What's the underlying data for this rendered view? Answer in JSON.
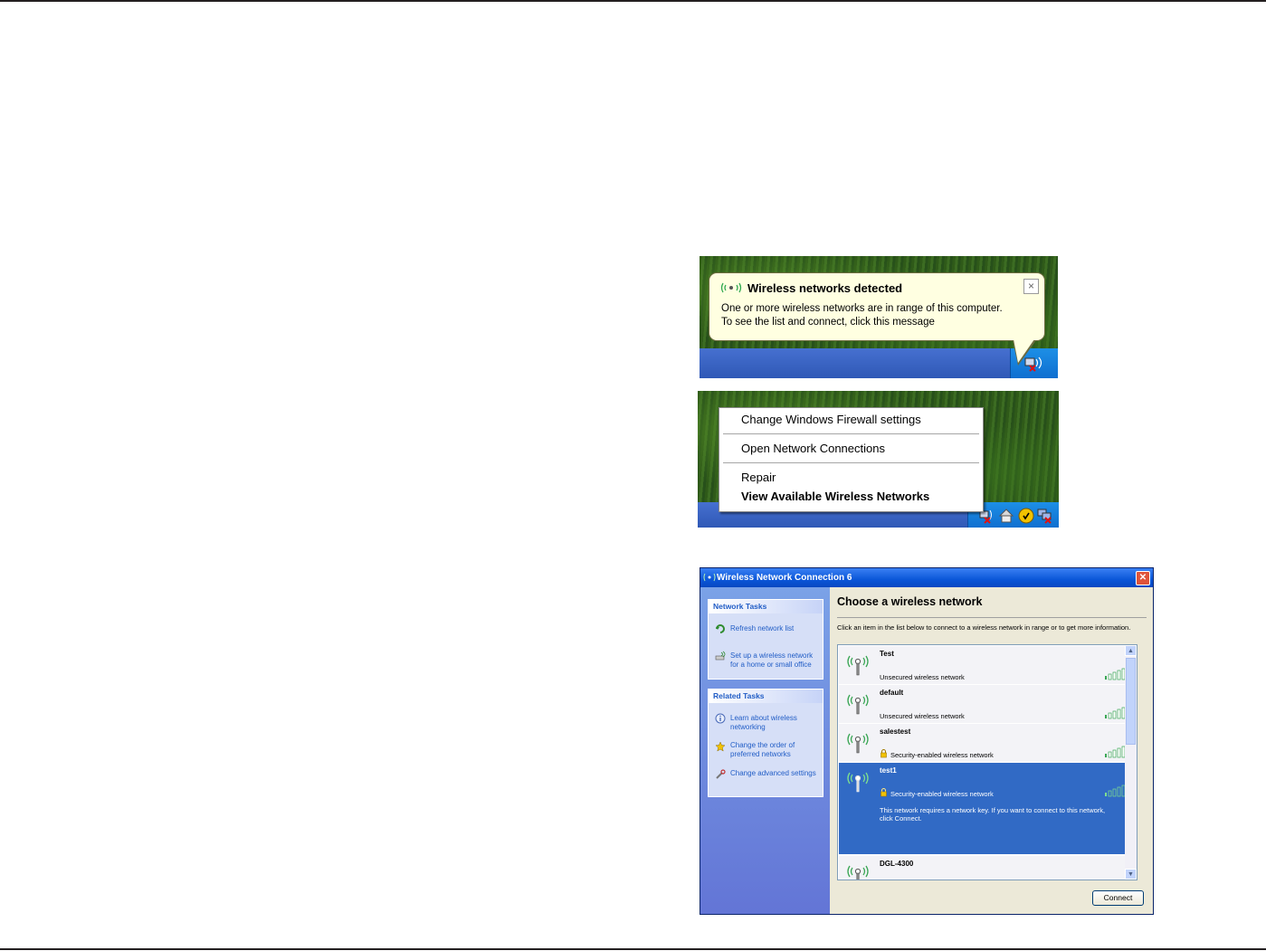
{
  "balloon": {
    "title": "Wireless networks detected",
    "message_line1": "One or more wireless networks are in range of this computer.",
    "message_line2": "To see the list and connect, click this message",
    "close": "×"
  },
  "context_menu": {
    "items": [
      "Change Windows Firewall settings",
      "Open Network Connections",
      "Repair",
      "View Available Wireless Networks"
    ]
  },
  "window": {
    "title": "Wireless Network Connection 6",
    "close": "✕",
    "network_tasks": {
      "header": "Network Tasks",
      "items": [
        "Refresh network list",
        "Set up a wireless network for a home or small office"
      ]
    },
    "related_tasks": {
      "header": "Related Tasks",
      "items": [
        "Learn about wireless networking",
        "Change the order of preferred networks",
        "Change advanced settings"
      ]
    },
    "heading": "Choose a wireless network",
    "description": "Click an item in the list below to connect to a wireless network in range or to get more information.",
    "networks": [
      {
        "name": "Test",
        "status": "Unsecured wireless network",
        "secured": false,
        "selected": false
      },
      {
        "name": "default",
        "status": "Unsecured wireless network",
        "secured": false,
        "selected": false
      },
      {
        "name": "salestest",
        "status": "Security-enabled wireless network",
        "secured": true,
        "selected": false
      },
      {
        "name": "test1",
        "status": "Security-enabled wireless network",
        "secured": true,
        "selected": true,
        "extra": "This network requires a network key. If you want to connect to this network, click Connect."
      },
      {
        "name": "DGL-4300",
        "status": "",
        "secured": false,
        "selected": false
      }
    ],
    "connect_button": "Connect"
  },
  "colors": {
    "taskbar": "#3a63c6",
    "balloon_bg": "#ffffe1",
    "selection": "#316ac5",
    "titlebar": "#0a56d8"
  }
}
